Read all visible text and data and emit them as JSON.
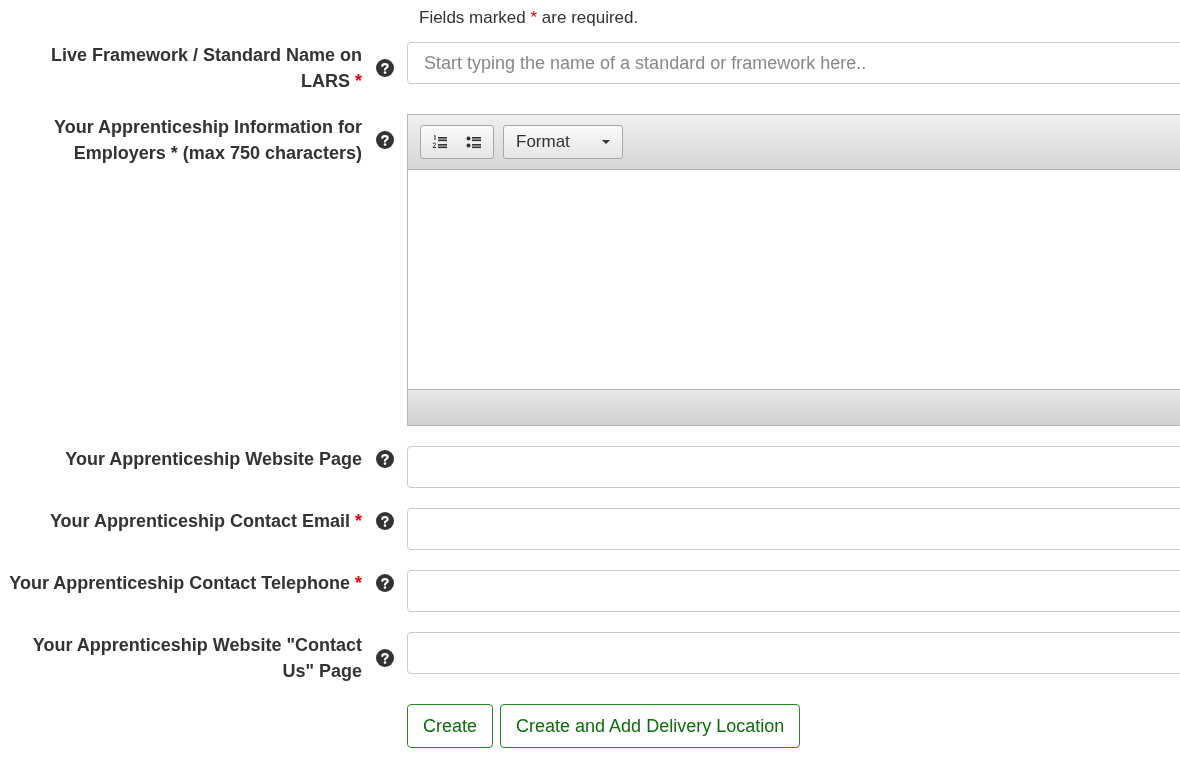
{
  "required_note": {
    "before": "Fields marked",
    "mark": "*",
    "after": "are required."
  },
  "fields": [
    {
      "kind": "text",
      "label": "Live Framework / Standard Name on LARS",
      "required": true,
      "placeholder": "Start typing the name of a standard or framework here.."
    },
    {
      "kind": "editor",
      "label": "Your Apprenticeship Information for Employers * (max 750 characters)",
      "required": false,
      "format_label": "Format"
    },
    {
      "kind": "text",
      "label": "Your Apprenticeship Website Page",
      "required": false
    },
    {
      "kind": "text",
      "label": "Your Apprenticeship Contact Email",
      "required": true
    },
    {
      "kind": "text",
      "label": "Your Apprenticeship Contact Telephone",
      "required": true
    },
    {
      "kind": "text",
      "label": "Your Apprenticeship Website \"Contact Us\" Page",
      "required": false
    }
  ],
  "buttons": [
    "Create",
    "Create and Add Delivery Location"
  ]
}
